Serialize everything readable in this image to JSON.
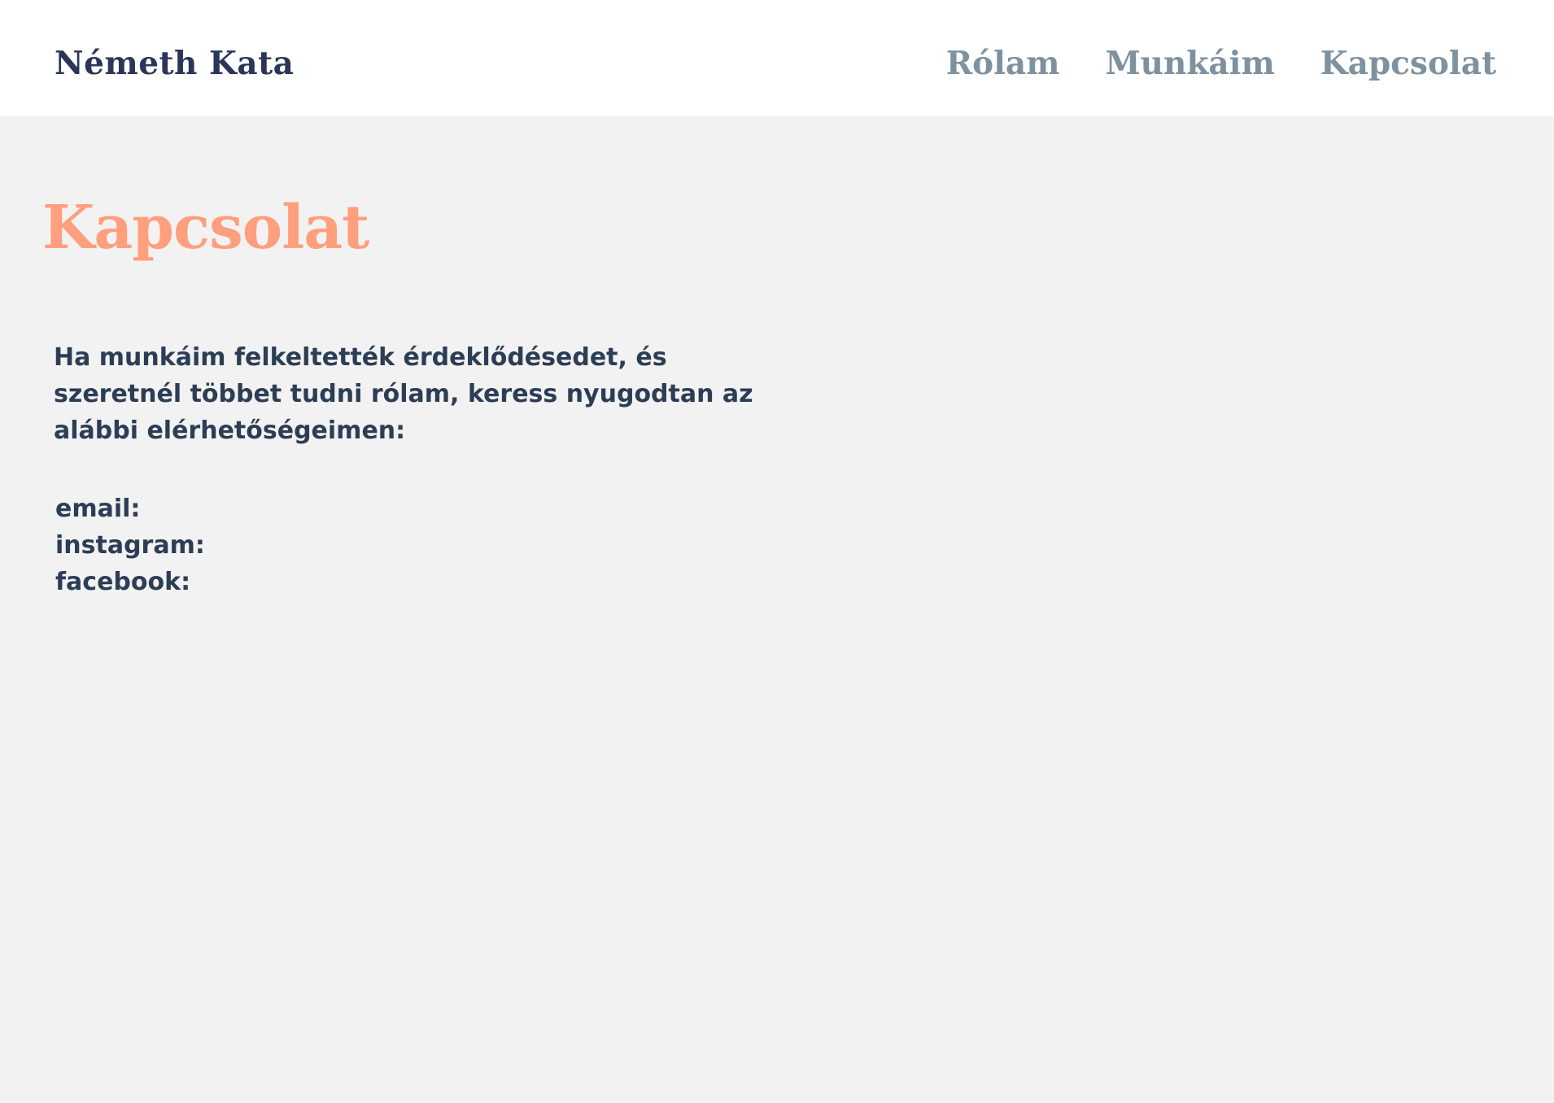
{
  "header": {
    "brand": "Németh Kata",
    "nav": [
      {
        "label": "Rólam"
      },
      {
        "label": "Munkáim"
      },
      {
        "label": "Kapcsolat"
      }
    ]
  },
  "main": {
    "title": "Kapcsolat",
    "intro": "Ha munkáim felkeltették érdeklődésedet, és szeretnél többet tudni rólam, keress nyugodtan az alábbi elérhetőségeimen:",
    "contacts": [
      {
        "label": "email:"
      },
      {
        "label": "instagram:"
      },
      {
        "label": "facebook:"
      }
    ]
  },
  "colors": {
    "brand": "#2a3558",
    "nav": "#7e919e",
    "accent": "#ff9f7e",
    "text": "#2c3e55",
    "background": "#f2f2f2",
    "header_background": "#ffffff"
  }
}
